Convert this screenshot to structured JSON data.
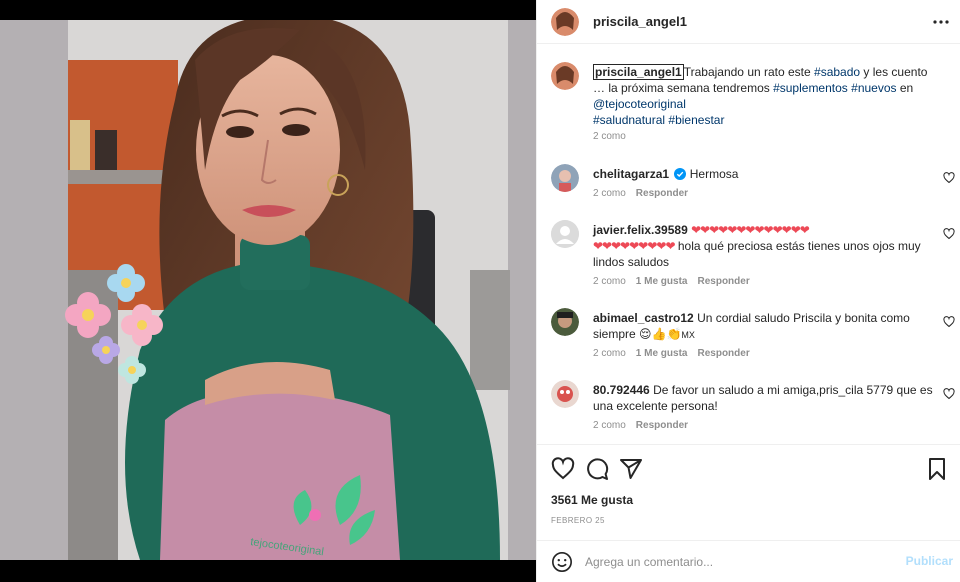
{
  "post": {
    "author": "priscila_angel1",
    "caption_start": "Trabajando un rato este ",
    "caption_tag_sabado": "#sabado",
    "caption_mid": " y les cuento … la próxima semana tendremos ",
    "caption_tag_suplementos": "#suplementos",
    "caption_tag_nuevos": "#nuevos",
    "caption_connector": " en ",
    "caption_mention": "@tejocoteoriginal",
    "caption_tag_saludnatural": "#saludnatural",
    "caption_tag_bienestar": "#bienestar",
    "caption_time": "2 como",
    "likes": "3561 Me gusta",
    "date": "FEBRERO 25",
    "photo_shirt_text": "tejocoteoriginal"
  },
  "comments": [
    {
      "user": "chelitagarza1",
      "text": "Hermosa",
      "time": "2 como",
      "reply": "Responder"
    },
    {
      "user": "javier.felix.39589",
      "hearts_line1": "❤❤❤❤❤❤❤❤❤❤❤❤❤",
      "hearts_line2": "❤❤❤❤❤❤❤❤❤",
      "text": "hola qué preciosa estás tienes unos ojos muy lindos saludos",
      "time": "2 como",
      "likes": "1 Me gusta",
      "reply": "Responder"
    },
    {
      "user": "abimael_castro12",
      "text": "Un cordial saludo Priscila y bonita como siempre ",
      "emojis": "😌👍👏",
      "suffix": "MX",
      "time": "2 como",
      "likes": "1 Me gusta",
      "reply": "Responder"
    },
    {
      "user": "80.792446",
      "text": "De favor un saludo a mi amiga,pris_cila 5779 que es una excelente persona!",
      "time": "2 como",
      "reply": "Responder"
    }
  ],
  "comment_box": {
    "placeholder": "Agrega un comentario...",
    "publish_label": "Publicar"
  },
  "colors": {
    "text": "#262626",
    "muted": "#8e8e8e",
    "hashtag": "#00376b",
    "publish_disabled": "#b2dffc",
    "heart_red": "#ed4956",
    "verified": "#0095f6"
  },
  "icons": {
    "more": "more-horizontal-icon",
    "like": "heart-outline-icon",
    "comment": "comment-bubble-icon",
    "share": "paper-plane-icon",
    "save": "bookmark-icon",
    "emoji": "smiley-icon"
  }
}
